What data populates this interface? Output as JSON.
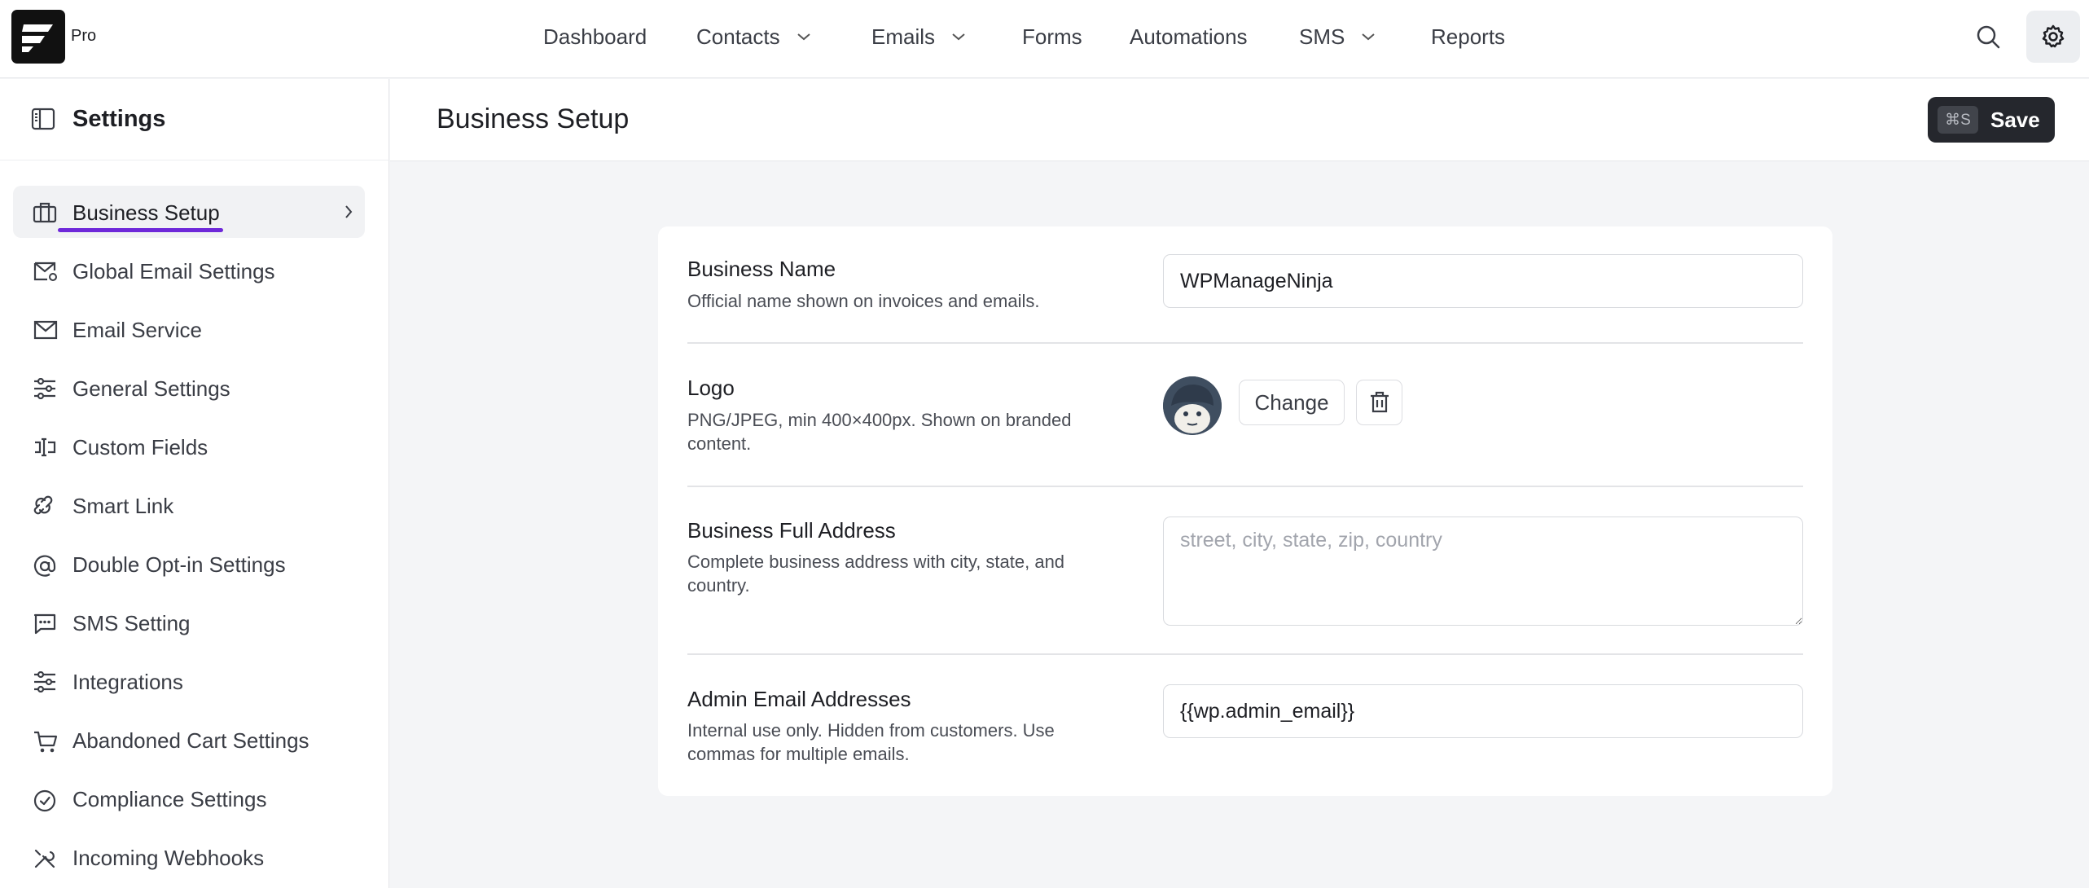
{
  "brand": {
    "badge": "Pro"
  },
  "nav": {
    "items": [
      {
        "label": "Dashboard"
      },
      {
        "label": "Contacts"
      },
      {
        "label": "Emails"
      },
      {
        "label": "Forms"
      },
      {
        "label": "Automations"
      },
      {
        "label": "SMS"
      },
      {
        "label": "Reports"
      }
    ]
  },
  "sidebar": {
    "title": "Settings",
    "items": [
      {
        "label": "Business Setup",
        "icon": "briefcase-icon",
        "active": true
      },
      {
        "label": "Global Email Settings",
        "icon": "mail-gear-icon"
      },
      {
        "label": "Email Service",
        "icon": "mail-icon"
      },
      {
        "label": "General Settings",
        "icon": "sliders-icon"
      },
      {
        "label": "Custom Fields",
        "icon": "text-cursor-icon"
      },
      {
        "label": "Smart Link",
        "icon": "link-icon"
      },
      {
        "label": "Double Opt-in Settings",
        "icon": "at-icon"
      },
      {
        "label": "SMS Setting",
        "icon": "message-icon"
      },
      {
        "label": "Integrations",
        "icon": "sliders-icon"
      },
      {
        "label": "Abandoned Cart Settings",
        "icon": "cart-icon"
      },
      {
        "label": "Compliance Settings",
        "icon": "check-circle-icon"
      },
      {
        "label": "Incoming Webhooks",
        "icon": "tools-icon"
      }
    ],
    "accent_color": "#6e28d9"
  },
  "header": {
    "title": "Business Setup",
    "save": {
      "shortcut": "⌘S",
      "label": "Save"
    }
  },
  "form": {
    "business_name": {
      "title": "Business Name",
      "description": "Official name shown on invoices and emails.",
      "value": "WPManageNinja"
    },
    "logo": {
      "title": "Logo",
      "description": "PNG/JPEG, min 400×400px. Shown on branded content.",
      "change_label": "Change"
    },
    "address": {
      "title": "Business Full Address",
      "description": "Complete business address with city, state, and country.",
      "placeholder": "street, city, state, zip, country",
      "value": ""
    },
    "admin_email": {
      "title": "Admin Email Addresses",
      "description": "Internal use only. Hidden from customers. Use commas for multiple emails.",
      "value": "{{wp.admin_email}}"
    }
  }
}
